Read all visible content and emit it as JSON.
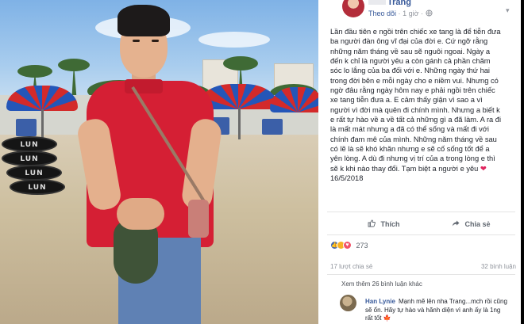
{
  "post": {
    "author": "Trang",
    "follow_label": "Theo dõi",
    "timestamp": "1 giờ",
    "privacy_icon": "globe-icon",
    "body": "Lần đầu tiên e ngồi trên chiếc xe tang là để tiễn đưa\nba người đàn ông vĩ đại của đời e. Cứ ngỡ rằng\nnhững năm tháng về sau sẽ nguôi ngoai. Ngày a\nđến k chỉ là người yêu a còn gánh cả phần chăm\nsóc lo lắng của ba đối với e. Những ngày thứ hai\ntrong đời bên e mỗi ngày cho e niềm vui. Nhưng có\nngờ đâu rằng ngày hôm nay e phải ngồi trên chiếc\nxe tang tiễn đưa a. E cảm thấy giận vì sao a vì\nngười vì đời mà quên đi chính mình. Nhưng a biết k\ne rất tự hào về a về tất cả những gì a đã làm. A ra đi\nlà mất mát nhưng a đã có thể sống và mất đi với\nchính đam mê của mình. Những năm tháng về sau\ncó lẽ là sẽ khó khăn nhưng e sẽ cố sống tốt để a\nyên lòng. A dù đi nhưng vị trí của a trong lòng e thì\nsẽ k khi nào thay đổi. Tạm biệt a người e yêu ",
    "heart": "❤",
    "date": "16/5/2018"
  },
  "actions": {
    "like_label": "Thích",
    "share_label": "Chia sẻ"
  },
  "reactions": {
    "count": "273"
  },
  "stats": {
    "shares": "17 lượt chia sẻ",
    "comments": "32 bình luận"
  },
  "more_comments": "Xem thêm 26 bình luận khác",
  "comment": {
    "name": "Han Lynie",
    "text": "Mạnh mẽ lên nha Trang...mch rồi cũng sẽ ổn. Hãy tự hào và hãnh diện vì anh ấy là 1ng rất tốt",
    "emoji": "🍁"
  },
  "colors": {
    "accent": "#365899",
    "shirt": "#d51f34",
    "heart": "#e0245e"
  }
}
